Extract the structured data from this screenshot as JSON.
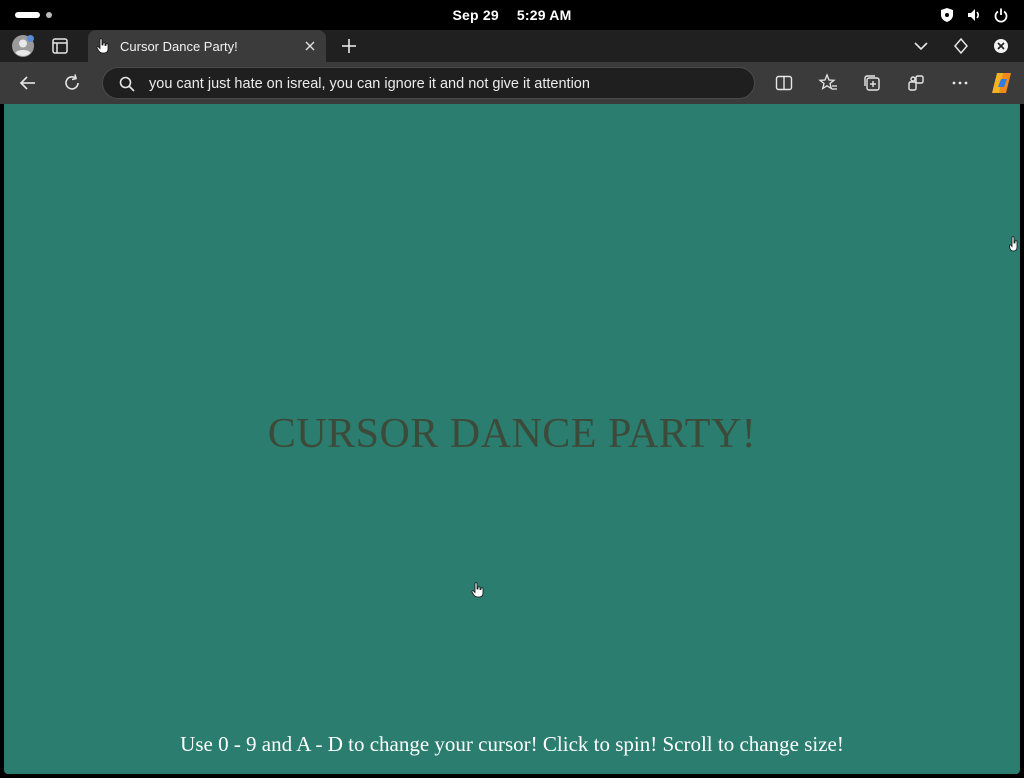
{
  "os_bar": {
    "date": "Sep 29",
    "time": "5:29 AM"
  },
  "browser": {
    "tab": {
      "title": "Cursor Dance Party!"
    },
    "address_bar": {
      "value": "you cant just hate on isreal, you can ignore it and not give it attention"
    },
    "icons": {
      "profile": "profile-icon",
      "tab_actions": "tab-actions-icon",
      "new_tab": "plus-icon",
      "back": "back-arrow-icon",
      "refresh": "refresh-icon",
      "search": "search-icon",
      "split_screen": "split-screen-icon",
      "favorites": "favorites-star-icon",
      "collections": "collections-icon",
      "extensions": "extensions-icon",
      "more": "more-icon",
      "copilot": "copilot-icon"
    }
  },
  "page": {
    "background": "#2b7d6f",
    "title": "CURSOR DANCE PARTY!",
    "title_color": "#3c4a3a",
    "hint": "Use 0 - 9 and A - D to change your cursor! Click to spin! Scroll to change size!"
  }
}
